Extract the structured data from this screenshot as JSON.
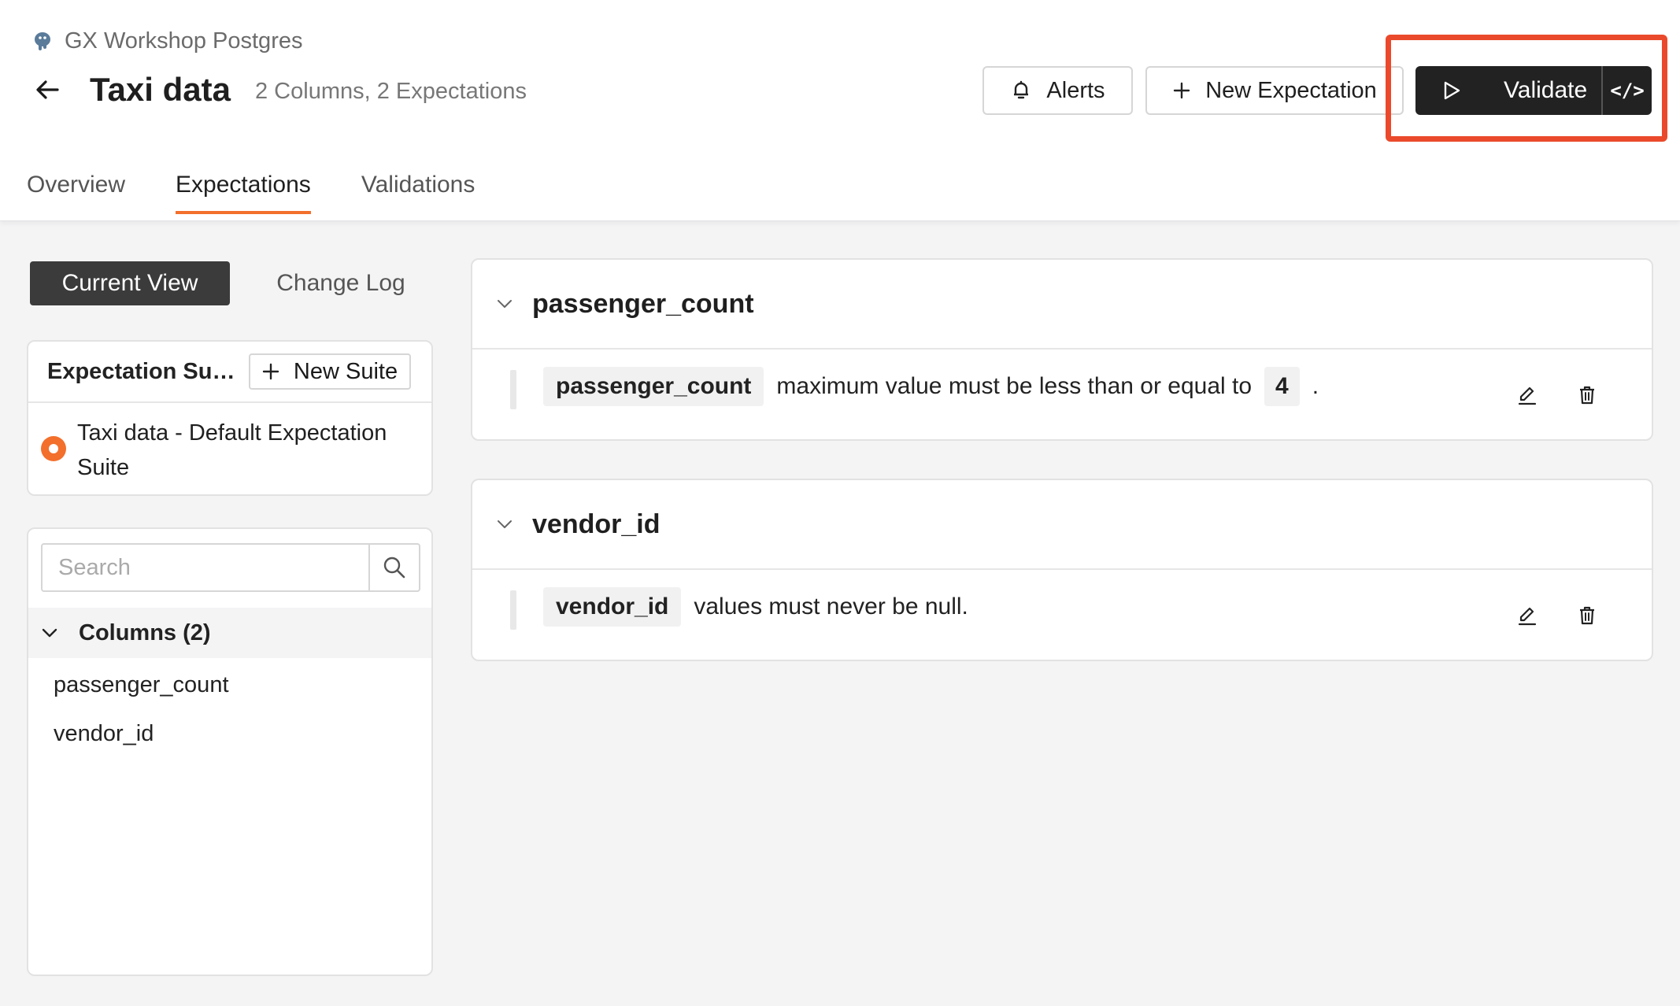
{
  "header": {
    "datasource": "GX Workshop Postgres",
    "title": "Taxi data",
    "subtitle": "2 Columns, 2 Expectations",
    "alerts_label": "Alerts",
    "new_expectation_label": "New Expectation",
    "validate_label": "Validate",
    "code_label": "</>"
  },
  "tabs": [
    {
      "label": "Overview"
    },
    {
      "label": "Expectations"
    },
    {
      "label": "Validations"
    }
  ],
  "active_tab": "Expectations",
  "view_toggle": {
    "current": "Current View",
    "changelog": "Change Log"
  },
  "suite_panel": {
    "heading": "Expectation Suit...",
    "new_suite_label": "New Suite",
    "items": [
      {
        "name": "Taxi data - Default Expectation Suite",
        "selected": true
      }
    ]
  },
  "columns_panel": {
    "search_placeholder": "Search",
    "heading": "Columns (2)",
    "columns": [
      "passenger_count",
      "vendor_id"
    ]
  },
  "expectations": [
    {
      "column": "passenger_count",
      "chip": "passenger_count",
      "text": "maximum value must be less than or equal to",
      "value": "4",
      "suffix": "."
    },
    {
      "column": "vendor_id",
      "chip": "vendor_id",
      "text": "values must never be null."
    }
  ],
  "colors": {
    "accent": "#f36f2c",
    "highlight": "#ea4a2b",
    "dark_button": "#222222"
  }
}
